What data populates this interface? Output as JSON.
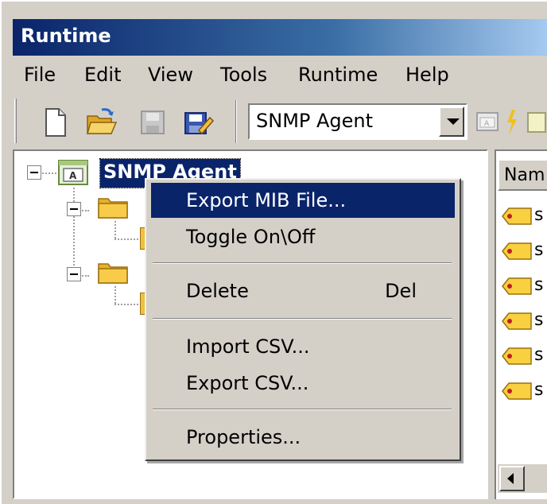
{
  "window": {
    "title": "Runtime"
  },
  "menubar": {
    "items": [
      "File",
      "Edit",
      "View",
      "Tools",
      "Runtime",
      "Help"
    ]
  },
  "toolbar": {
    "buttons": [
      "new-document-icon",
      "open-folder-icon",
      "save-disabled-icon",
      "save-edit-icon"
    ],
    "combo": {
      "value": "SNMP Agent"
    }
  },
  "tree": {
    "root": {
      "label": "SNMP Agent",
      "icon": "agent-icon"
    }
  },
  "list": {
    "column_header": "Nam",
    "rows": [
      "s",
      "s",
      "s",
      "s",
      "s",
      "s"
    ]
  },
  "context_menu": {
    "items": [
      {
        "label": "Export MIB File...",
        "shortcut": "",
        "highlighted": true
      },
      {
        "label": "Toggle On\\Off",
        "shortcut": ""
      },
      {
        "label": "Delete",
        "shortcut": "Del"
      },
      {
        "label": "Import CSV...",
        "shortcut": ""
      },
      {
        "label": "Export CSV...",
        "shortcut": ""
      },
      {
        "label": "Properties...",
        "shortcut": ""
      }
    ]
  },
  "colors": {
    "title_bg": "#0a246a",
    "selection": "#0a246a",
    "face": "#d4d0c8"
  }
}
